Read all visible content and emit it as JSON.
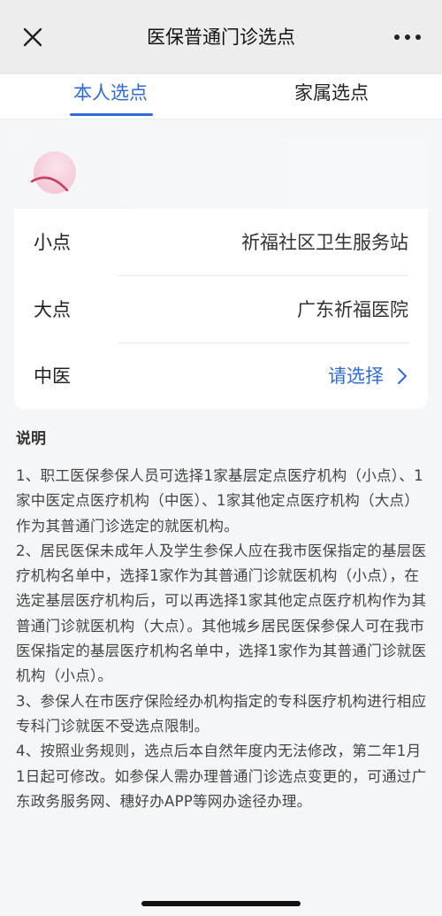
{
  "header": {
    "title": "医保普通门诊选点",
    "close_icon": "close-icon",
    "more_icon": "more-icon"
  },
  "tabs": [
    {
      "label": "本人选点",
      "active": true
    },
    {
      "label": "家属选点",
      "active": false
    }
  ],
  "card": {
    "rows": [
      {
        "label": "小点",
        "value": "祈福社区卫生服务站"
      },
      {
        "label": "大点",
        "value": "广东祈福医院"
      },
      {
        "label": "中医",
        "value": "请选择"
      }
    ]
  },
  "notes": {
    "title": "说明",
    "items": [
      "1、职工医保参保人员可选择1家基层定点医疗机构（小点）、1家中医定点医疗机构（中医）、1家其他定点医疗机构（大点）作为其普通门诊选定的就医机构。",
      "2、居民医保未成年人及学生参保人应在我市医保指定的基层医疗机构名单中，选择1家作为其普通门诊就医机构（小点），在选定基层医疗机构后，可以再选择1家其他定点医疗机构作为其普通门诊就医机构（大点）。其他城乡居民医保参保人可在我市医保指定的基层医疗机构名单中，选择1家作为其普通门诊就医机构（小点）。",
      "3、参保人在市医疗保险经办机构指定的专科医疗机构进行相应专科门诊就医不受选点限制。",
      "4、按照业务规则，选点后本自然年度内无法修改，第二年1月1日起可修改。如参保人需办理普通门诊选点变更的，可通过广东政务服务网、穗好办APP等网办途径办理。"
    ]
  },
  "colors": {
    "accent": "#2f6bd8",
    "nav_bg": "#ededed",
    "page_bg": "#f5f6f8"
  }
}
